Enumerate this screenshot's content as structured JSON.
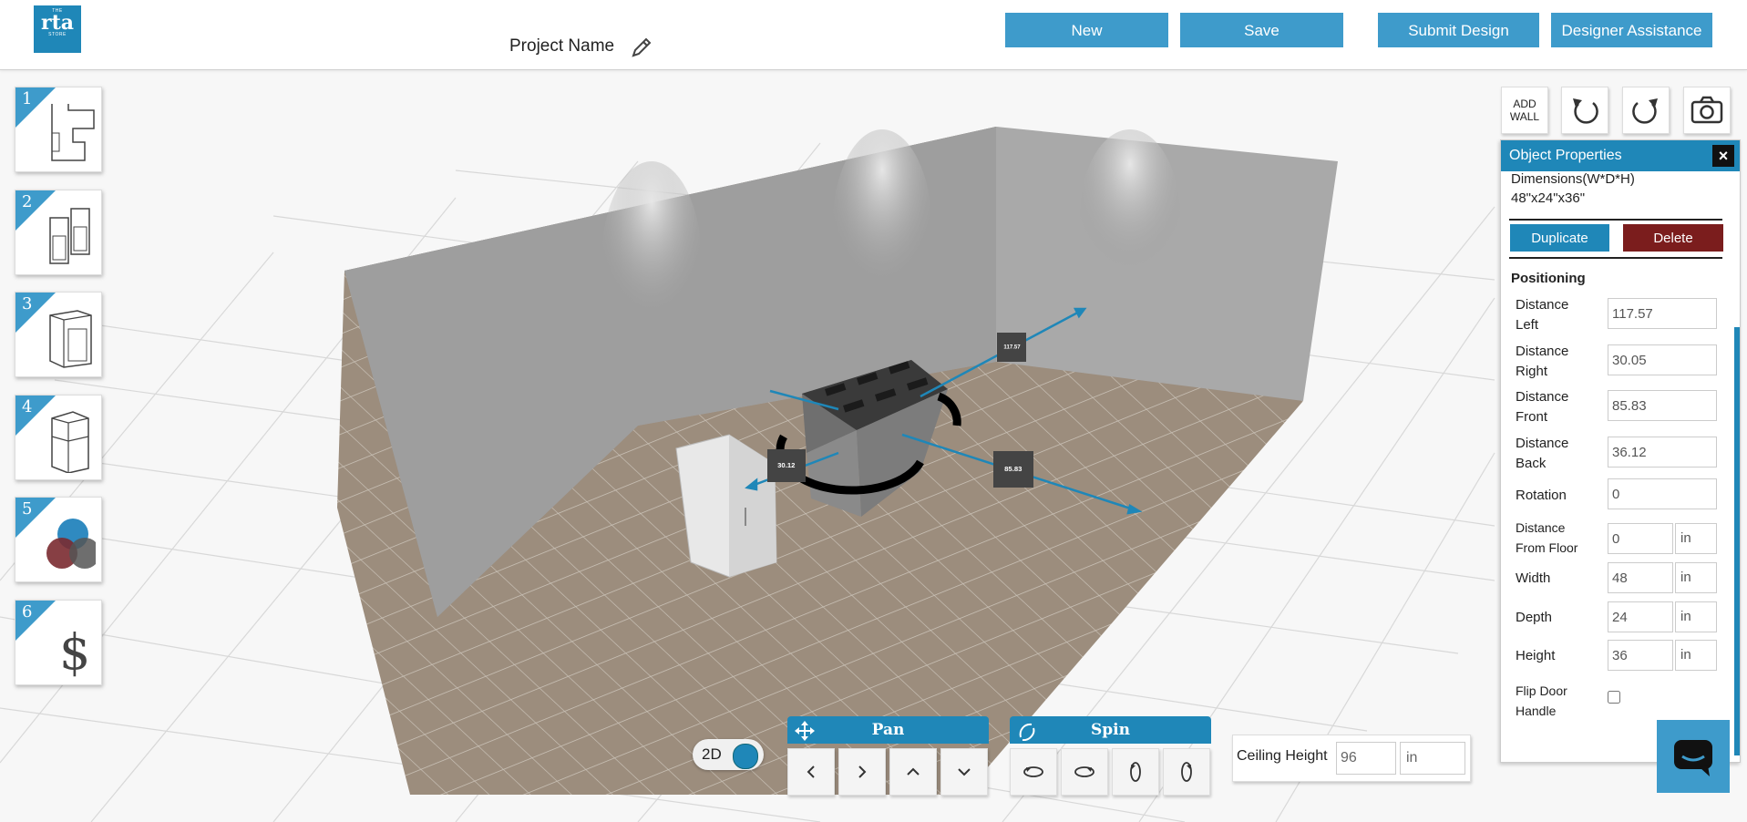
{
  "header": {
    "logo": {
      "top": "THE",
      "main": "rta",
      "bottom": "STORE"
    },
    "project_name": "Project Name",
    "buttons": {
      "new": "New",
      "save": "Save",
      "submit": "Submit Design",
      "assist": "Designer Assistance"
    }
  },
  "steps": [
    {
      "num": "1",
      "icon": "floorplan-icon"
    },
    {
      "num": "2",
      "icon": "wall-cabinets-icon"
    },
    {
      "num": "3",
      "icon": "base-cabinet-icon"
    },
    {
      "num": "4",
      "icon": "refrigerator-icon"
    },
    {
      "num": "5",
      "icon": "color-finish-icon"
    },
    {
      "num": "6",
      "icon": "dollar-icon"
    }
  ],
  "tools": {
    "add_wall": "ADD WALL",
    "undo_icon": "undo-icon",
    "redo_icon": "redo-icon",
    "camera_icon": "camera-icon"
  },
  "scene": {
    "labels": {
      "right": "117.57",
      "front": "85.83",
      "left": "30.12"
    },
    "accent": "#1f87b8"
  },
  "properties": {
    "title": "Object Properties",
    "dimensions_label": "Dimensions(W*D*H)",
    "dimensions_value": "48\"x24\"x36\"",
    "duplicate": "Duplicate",
    "delete": "Delete",
    "positioning": "Positioning",
    "distance_left_1": "Distance",
    "distance_left_2": "Left",
    "distance_left_val": "117.57",
    "distance_right_1": "Distance",
    "distance_right_2": "Right",
    "distance_right_val": "30.05",
    "distance_front_1": "Distance",
    "distance_front_2": "Front",
    "distance_front_val": "85.83",
    "distance_back_1": "Distance",
    "distance_back_2": "Back",
    "distance_back_val": "36.12",
    "rotation": "Rotation",
    "rotation_val": "0",
    "floor_1": "Distance",
    "floor_2": "From Floor",
    "floor_val": "0",
    "floor_unit": "in",
    "width": "Width",
    "width_val": "48",
    "width_unit": "in",
    "depth": "Depth",
    "depth_val": "24",
    "depth_unit": "in",
    "height": "Height",
    "height_val": "36",
    "height_unit": "in",
    "flip_1": "Flip Door",
    "flip_2": "Handle",
    "colors": {
      "duplicate": "#1f87b8",
      "delete": "#7b1d1d"
    }
  },
  "controls": {
    "toggle_label": "2D",
    "pan": "Pan",
    "spin": "Spin",
    "pan_buttons": [
      "pan-left-icon",
      "pan-right-icon",
      "pan-up-icon",
      "pan-down-icon"
    ],
    "spin_buttons": [
      "spin-left-icon",
      "spin-right-icon",
      "tilt-up-icon",
      "tilt-down-icon"
    ]
  },
  "ceiling": {
    "label": "Ceiling Height",
    "value": "96",
    "unit": "in"
  }
}
